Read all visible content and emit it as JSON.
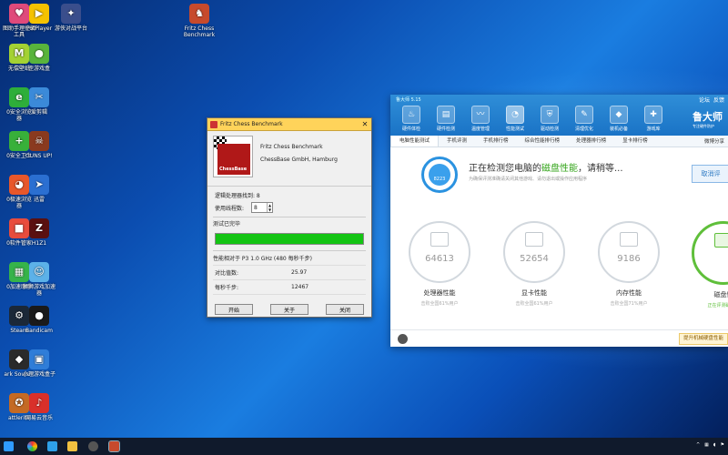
{
  "desktop": {
    "icons": [
      {
        "label": "图助手理控钢\n工具",
        "icon": "lala-app-icon",
        "color": "#e04a7b",
        "glyph": "♥"
      },
      {
        "label": "PotPlayer",
        "icon": "potplayer-icon",
        "color": "#f5c200",
        "glyph": "▶"
      },
      {
        "label": "游侠对战平台",
        "icon": "game-platform-icon",
        "color": "#3a4e8c",
        "glyph": "✦"
      },
      {
        "label": "Fritz Chess\nBenchmark",
        "icon": "fritz-chess-icon",
        "color": "#c74a2c",
        "glyph": "♞"
      },
      {
        "label": "无偿壁纸",
        "icon": "wallpaper-icon",
        "color": "#a4d233",
        "glyph": "M"
      },
      {
        "label": "歪游戏盒",
        "icon": "game-box-icon",
        "color": "#59b43c",
        "glyph": "●"
      },
      {
        "label": "0安全浏览\n器",
        "icon": "safe-browser-icon",
        "color": "#2eae3a",
        "glyph": "e"
      },
      {
        "label": "爱剪辑",
        "icon": "video-editor-icon",
        "color": "#3b8ad9",
        "glyph": "✂"
      },
      {
        "label": "0安全卫士",
        "icon": "security-guard-icon",
        "color": "#38b03a",
        "glyph": "+"
      },
      {
        "label": "GUNS UP!",
        "icon": "guns-up-icon",
        "color": "#8a3a1f",
        "glyph": "☠"
      },
      {
        "label": "0极速浏览\n器",
        "icon": "speed-browser-icon",
        "color": "#e8572a",
        "glyph": "◕"
      },
      {
        "label": "迅雷",
        "icon": "thunder-icon",
        "color": "#2b6fd1",
        "glyph": "➤"
      },
      {
        "label": "0软件管家",
        "icon": "software-manager-icon",
        "color": "#e84c3d",
        "glyph": "■"
      },
      {
        "label": "H1Z1",
        "icon": "h1z1-icon",
        "color": "#5a1010",
        "glyph": "Z"
      },
      {
        "label": "0加速助手",
        "icon": "accelerator-icon",
        "color": "#36b34a",
        "glyph": "▦"
      },
      {
        "label": "狮狮游戏加速\n器",
        "icon": "game-accelerator-icon",
        "color": "#5cb1e8",
        "glyph": "☺"
      },
      {
        "label": "Steam",
        "icon": "steam-icon",
        "color": "#1b2838",
        "glyph": "⚙"
      },
      {
        "label": "Bandicam",
        "icon": "bandicam-icon",
        "color": "#1a1a1a",
        "glyph": "●"
      },
      {
        "label": "ark Souls...",
        "icon": "dark-souls-icon",
        "color": "#2a2a2a",
        "glyph": "◆"
      },
      {
        "label": "小理游戏盒子",
        "icon": "game-box-2-icon",
        "color": "#2f7dd8",
        "glyph": "▣"
      },
      {
        "label": "attlerite",
        "icon": "battlerite-icon",
        "color": "#c46a24",
        "glyph": "✪"
      },
      {
        "label": "网易云音乐",
        "icon": "netease-music-icon",
        "color": "#d9302a",
        "glyph": "♪"
      }
    ]
  },
  "fritz": {
    "title": "Fritz Chess Benchmark",
    "app_name": "Fritz Chess Benchmark",
    "company": "ChessBase GmbH, Hamburg",
    "logo_text": "ChessBase",
    "processors_label": "逻辑处理器找到: 8",
    "threads_label": "使用线程数:",
    "threads_value": "8",
    "status": "测试已完毕",
    "progress": 1.0,
    "results": [
      {
        "label": "性能相对于 P3 1.0 GHz (480 每秒千步)",
        "value": ""
      },
      {
        "label": "对比值数:",
        "value": "25.97"
      },
      {
        "label": "每秒千步:",
        "value": "12467"
      }
    ],
    "buttons": {
      "start": "开始",
      "about": "关于",
      "close": "关闭"
    }
  },
  "ludashi": {
    "title": "鲁大师 5.15",
    "top_links": [
      "论坛",
      "反馈"
    ],
    "nav": [
      {
        "label": "硬件体检",
        "icon": "hardware-check-icon",
        "glyph": "♨"
      },
      {
        "label": "硬件检测",
        "icon": "hardware-detect-icon",
        "glyph": "▤"
      },
      {
        "label": "温度管理",
        "icon": "temperature-icon",
        "glyph": "〰"
      },
      {
        "label": "性能测试",
        "icon": "performance-test-icon",
        "glyph": "◔"
      },
      {
        "label": "驱动检测",
        "icon": "driver-icon",
        "glyph": "⛨"
      },
      {
        "label": "清理优化",
        "icon": "clean-icon",
        "glyph": "✎"
      },
      {
        "label": "装机必备",
        "icon": "install-icon",
        "glyph": "◆"
      },
      {
        "label": "游戏库",
        "icon": "game-library-icon",
        "glyph": "✚"
      }
    ],
    "brand": "鲁大师",
    "brand_sub": "专注硬件防护",
    "tabs": [
      "电脑性能测试",
      "手机评测",
      "手机排行榜",
      "综合性能排行榜",
      "处理器排行榜",
      "显卡排行榜"
    ],
    "share": "微博分享",
    "scan_prefix": "正在检测您电脑的",
    "scan_highlight": "磁盘性能",
    "scan_suffix": "，请稍等...",
    "scan_sub": "为确保评测准确请关闭其他游戏、请勿退出或操作应用程序",
    "cancel": "取消评",
    "gauge_text": "8223",
    "cards": [
      {
        "score": "64613",
        "label": "处理器性能",
        "sub": "击败全国61%用户",
        "icon": "cpu-icon"
      },
      {
        "score": "52654",
        "label": "显卡性能",
        "sub": "击败全国61%用户",
        "icon": "gpu-icon"
      },
      {
        "score": "9186",
        "label": "内存性能",
        "sub": "击败全国71%用户",
        "icon": "memory-icon"
      },
      {
        "score": "",
        "label": "磁盘性",
        "sub": "正在评测磁盘性",
        "icon": "disk-icon"
      }
    ],
    "upgrade": "提升机械硬盘性能"
  }
}
